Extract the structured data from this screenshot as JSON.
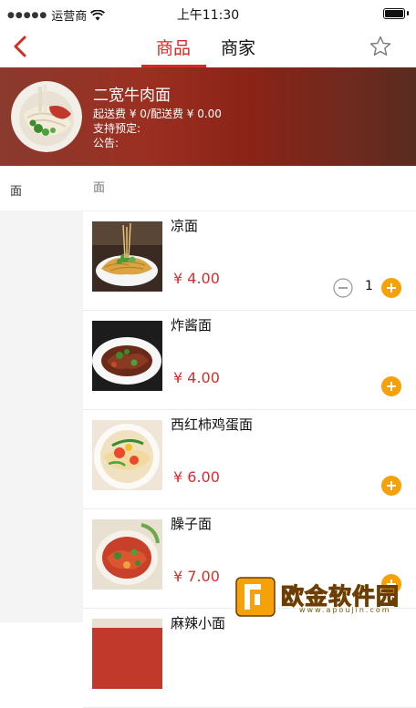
{
  "status_bar": {
    "carrier": "运营商",
    "time": "上午11:30"
  },
  "nav": {
    "tabs": [
      "商品",
      "商家"
    ],
    "active_tab": "商品"
  },
  "shop": {
    "name": "二宽牛肉面",
    "delivery": "起送费 ¥ 0/配送费 ¥ 0.00",
    "reservation": "支持预定:",
    "notice": "公告:"
  },
  "sidebar": {
    "categories": [
      "面"
    ]
  },
  "menu": {
    "section_title": "面",
    "items": [
      {
        "name": "凉面",
        "price": "¥ 4.00",
        "quantity": "1"
      },
      {
        "name": "炸酱面",
        "price": "¥ 4.00"
      },
      {
        "name": "西红柿鸡蛋面",
        "price": "¥ 6.00"
      },
      {
        "name": "臊子面",
        "price": "¥ 7.00"
      },
      {
        "name": "麻辣小面"
      }
    ]
  },
  "watermark": {
    "title": "欧金软件园",
    "url": "www.apoujin.com"
  },
  "colors": {
    "accent": "#d42b24",
    "price": "#d32f2f",
    "add_button": "#f5a10a",
    "header_bg": "#8b2317"
  }
}
